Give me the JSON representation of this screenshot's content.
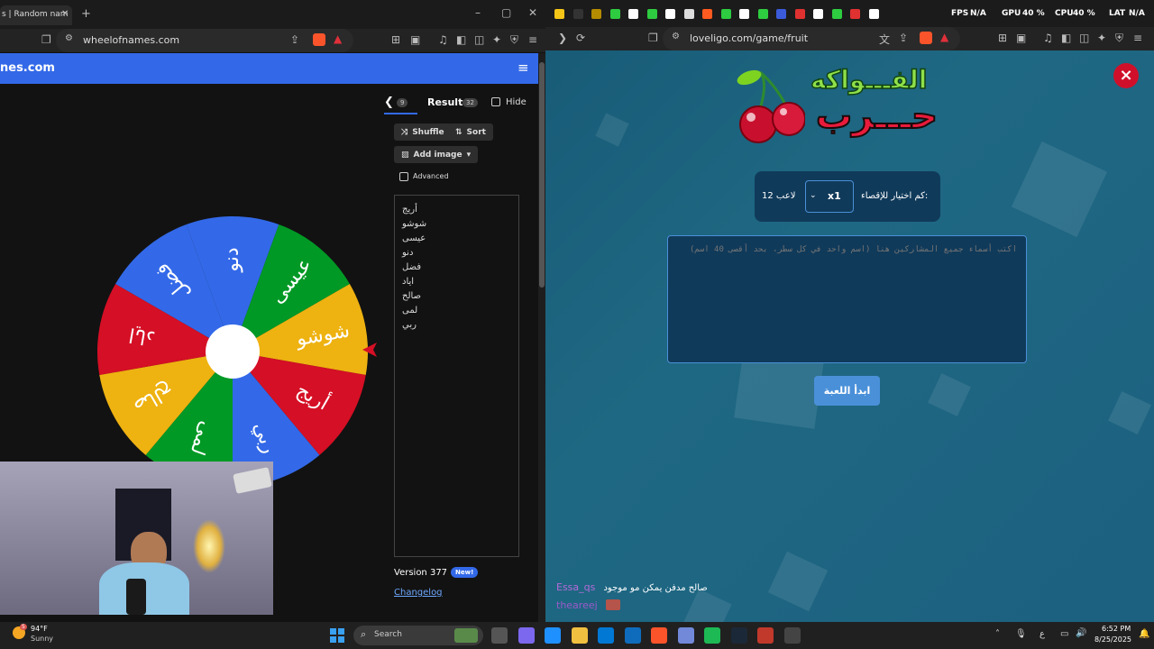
{
  "left_browser": {
    "tab_title": "s | Random nam",
    "url": "wheelofnames.com",
    "site_title": "nes.com",
    "tabs": {
      "entries_count": "9",
      "results_label": "Results",
      "results_count": "32",
      "hide_label": "Hide"
    },
    "buttons": {
      "shuffle": "Shuffle",
      "sort": "Sort",
      "add_image": "Add image",
      "advanced": "Advanced"
    },
    "entries": [
      "أريج",
      "شوشو",
      "عيسى",
      "دنو",
      "فضل",
      "اياد",
      "صالح",
      "لمى",
      "ربي"
    ],
    "wheel_labels": [
      "دنو",
      "عيسى",
      "شوشو",
      "أريج",
      "ربي",
      "لمى",
      "صالح",
      "اياد",
      "فضل"
    ],
    "wheel_colors": [
      "#3369e8",
      "#009925",
      "#eeb211",
      "#d50f25"
    ],
    "version_label": "Version 377",
    "new_badge": "New!",
    "changelog_link": "Changelog"
  },
  "right_browser": {
    "url": "loveligo.com/game/fruit",
    "perf_overlay": {
      "fps_label": "FPS",
      "fps_value": "N/A",
      "gpu_label": "GPU",
      "gpu_value": "40 %",
      "cpu_label": "CPU",
      "cpu_value": "40 %",
      "lat_label": "LAT",
      "lat_value": "N/A"
    },
    "logo_top": "الفـــواكه",
    "logo_bottom": "حـــرب",
    "selection_label": "كم اختيار للإقصاء:",
    "selection_value": "x1",
    "players_label": "12 لاعب",
    "textarea_placeholder": "اكتب أسماء جميع المشاركين هنا (اسم واحد في كل سطر، بحد أقصى 40 اسم)",
    "start_button": "ابدأ اللعبة",
    "close_icon": "×",
    "chat": [
      {
        "user": "Essa_qs",
        "message": "صالح مدفن يمكن مو موجود",
        "color": "#b46bd9"
      },
      {
        "user": "theareej",
        "message": "",
        "color": "#9b59c9"
      }
    ],
    "colors": {
      "bg": "#1b5f78",
      "accent": "#4a90d9",
      "panel": "#103a5a"
    }
  },
  "taskbar": {
    "weather_temp": "94°F",
    "weather_desc": "Sunny",
    "weather_badge": "5",
    "search_placeholder": "Search",
    "time": "6:52 PM",
    "date": "8/25/2025",
    "lang": "ع"
  }
}
